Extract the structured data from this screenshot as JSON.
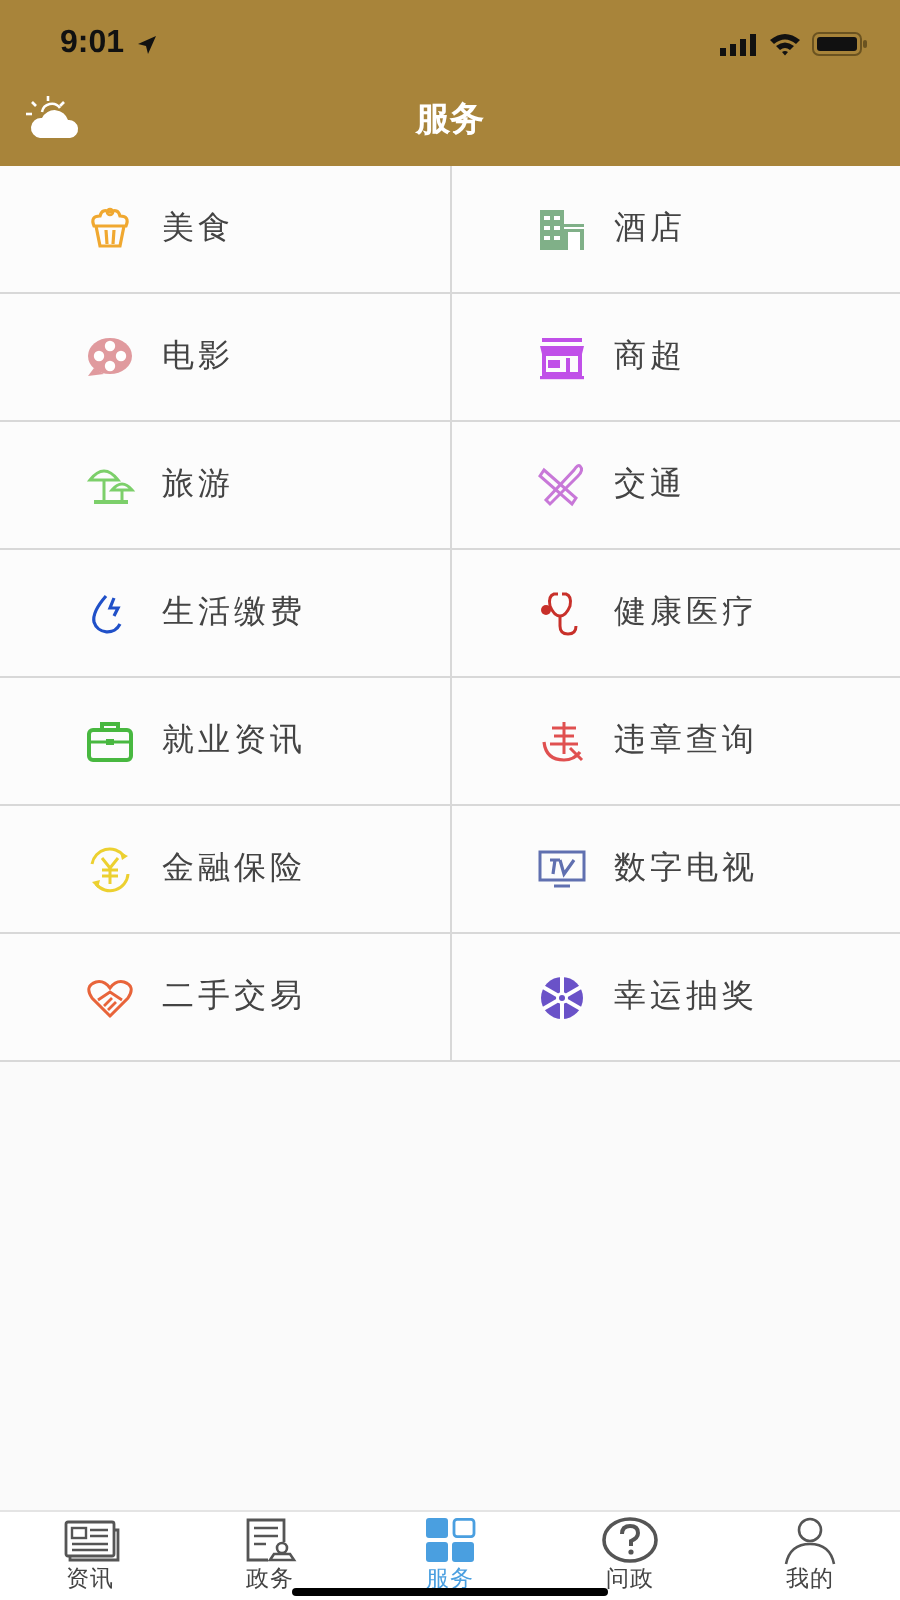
{
  "status_bar": {
    "time": "9:01"
  },
  "header": {
    "title": "服务"
  },
  "services": [
    {
      "label": "美食"
    },
    {
      "label": "酒店"
    },
    {
      "label": "电影"
    },
    {
      "label": "商超"
    },
    {
      "label": "旅游"
    },
    {
      "label": "交通"
    },
    {
      "label": "生活缴费"
    },
    {
      "label": "健康医疗"
    },
    {
      "label": "就业资讯"
    },
    {
      "label": "违章查询"
    },
    {
      "label": "金融保险"
    },
    {
      "label": "数字电视"
    },
    {
      "label": "二手交易"
    },
    {
      "label": "幸运抽奖"
    }
  ],
  "tab_bar": [
    {
      "label": "资讯",
      "selected": false
    },
    {
      "label": "政务",
      "selected": false
    },
    {
      "label": "服务",
      "selected": true
    },
    {
      "label": "问政",
      "selected": false
    },
    {
      "label": "我的",
      "selected": false
    }
  ]
}
